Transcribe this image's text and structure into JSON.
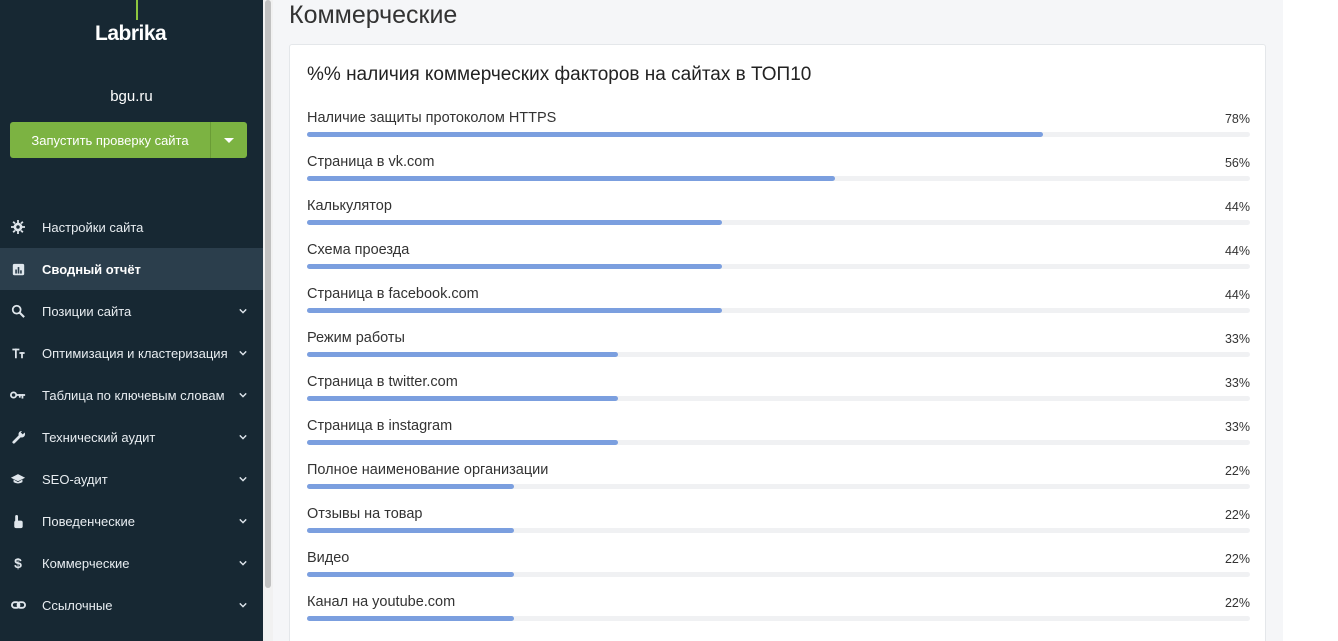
{
  "sidebar": {
    "logo": "Labrika",
    "site": "bgu.ru",
    "run_button": "Запустить проверку сайта",
    "items": [
      {
        "label": "Настройки сайта",
        "icon": "gear-icon",
        "chevron": false,
        "active": false
      },
      {
        "label": "Сводный отчёт",
        "icon": "chart-icon",
        "chevron": false,
        "active": true
      },
      {
        "label": "Позиции сайта",
        "icon": "search-icon",
        "chevron": true,
        "active": false
      },
      {
        "label": "Оптимизация и кластеризация",
        "icon": "text-size-icon",
        "chevron": true,
        "active": false
      },
      {
        "label": "Таблица по ключевым словам",
        "icon": "key-icon",
        "chevron": true,
        "active": false
      },
      {
        "label": "Технический аудит",
        "icon": "wrench-icon",
        "chevron": true,
        "active": false
      },
      {
        "label": "SEO-аудит",
        "icon": "graduation-cap-icon",
        "chevron": true,
        "active": false
      },
      {
        "label": "Поведенческие",
        "icon": "hand-pointer-icon",
        "chevron": true,
        "active": false
      },
      {
        "label": "Коммерческие",
        "icon": "dollar-icon",
        "chevron": true,
        "active": false
      },
      {
        "label": "Ссылочные",
        "icon": "link-icon",
        "chevron": true,
        "active": false
      }
    ]
  },
  "main": {
    "page_title": "Коммерческие",
    "card_title": "%% наличия коммерческих факторов на сайтах в ТОП10",
    "rows": [
      {
        "label": "Наличие защиты протоколом HTTPS",
        "pct_text": "78%",
        "value": 78
      },
      {
        "label": "Страница в vk.com",
        "pct_text": "56%",
        "value": 56
      },
      {
        "label": "Калькулятор",
        "pct_text": "44%",
        "value": 44
      },
      {
        "label": "Схема проезда",
        "pct_text": "44%",
        "value": 44
      },
      {
        "label": "Страница в facebook.com",
        "pct_text": "44%",
        "value": 44
      },
      {
        "label": "Режим работы",
        "pct_text": "33%",
        "value": 33
      },
      {
        "label": "Страница в twitter.com",
        "pct_text": "33%",
        "value": 33
      },
      {
        "label": "Страница в instagram",
        "pct_text": "33%",
        "value": 33
      },
      {
        "label": "Полное наименование организации",
        "pct_text": "22%",
        "value": 22
      },
      {
        "label": "Отзывы на товар",
        "pct_text": "22%",
        "value": 22
      },
      {
        "label": "Видео",
        "pct_text": "22%",
        "value": 22
      },
      {
        "label": "Канал на youtube.com",
        "pct_text": "22%",
        "value": 22
      }
    ]
  },
  "colors": {
    "sidebar_bg": "#172833",
    "accent_green": "#7cb342",
    "bar_fill": "#7b9fdf"
  }
}
